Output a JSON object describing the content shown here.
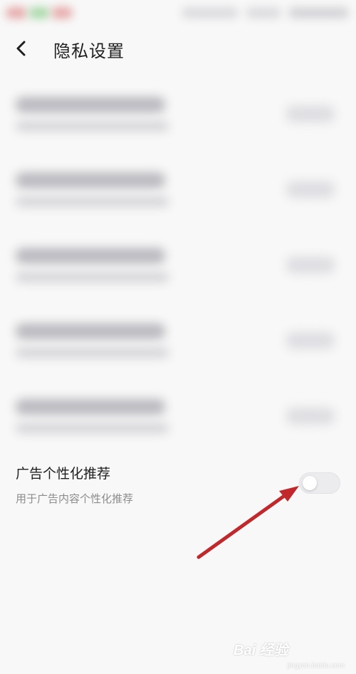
{
  "header": {
    "title": "隐私设置",
    "back_icon": "chevron-left-icon"
  },
  "ad_personalization": {
    "title": "广告个性化推荐",
    "subtitle": "用于广告内容个性化推荐",
    "toggle_on": false
  },
  "annotation": {
    "arrow_color": "#c0282b"
  },
  "watermark": {
    "main": "Bai 经验",
    "sub": "jingyan.baidu.com"
  },
  "colors": {
    "background": "#f8f8f8",
    "title_text": "#1e1e1e",
    "subtitle_text": "#8c8c8c",
    "toggle_off": "#ececef"
  }
}
